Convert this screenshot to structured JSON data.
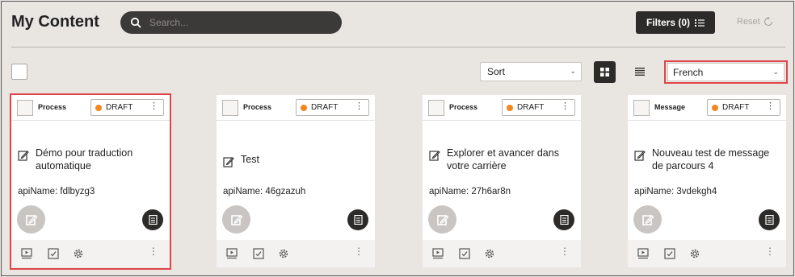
{
  "page": {
    "title": "My Content"
  },
  "search": {
    "placeholder": "Search..."
  },
  "toolbar": {
    "filters_label": "Filters (0)",
    "reset_label": "Reset",
    "sort_label": "Sort",
    "language_value": "French"
  },
  "cards": [
    {
      "type": "Process",
      "status": "DRAFT",
      "name": "Démo pour traduction automatique",
      "api": "apiName: fdlbyzg3",
      "highlighted": true
    },
    {
      "type": "Process",
      "status": "DRAFT",
      "name": "Test",
      "api": "apiName: 46gzazuh",
      "highlighted": false
    },
    {
      "type": "Process",
      "status": "DRAFT",
      "name": "Explorer et avancer dans votre carrière",
      "api": "apiName: 27h6ar8n",
      "highlighted": false
    },
    {
      "type": "Message",
      "status": "DRAFT",
      "name": "Nouveau test de message de parcours 4",
      "api": "apiName: 3vdekgh4",
      "highlighted": false
    }
  ],
  "colors": {
    "accent_dark": "#2d2b29",
    "highlight": "#e0434a",
    "status_dot": "#f2871f"
  },
  "icons": [
    "search-icon",
    "filter-list-icon",
    "reset-icon",
    "grid-view-icon",
    "list-view-icon",
    "edit-icon",
    "document-icon",
    "preview-icon",
    "checklist-icon",
    "gear-icon",
    "kebab-icon"
  ]
}
